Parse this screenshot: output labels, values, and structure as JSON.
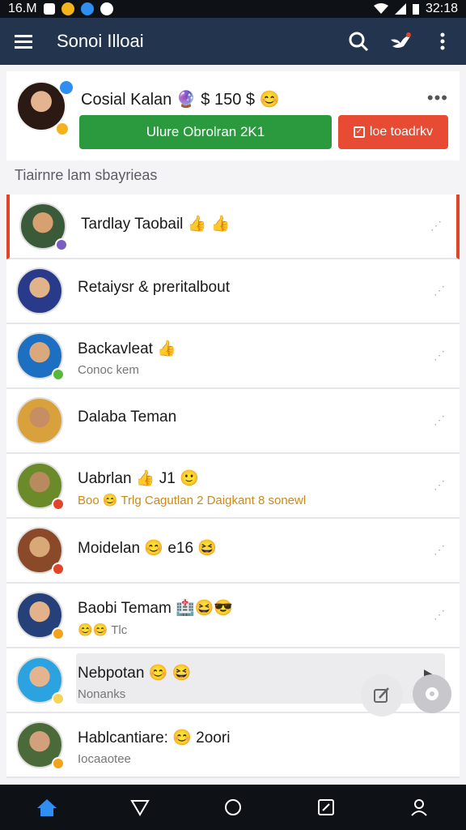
{
  "status_bar": {
    "time_left": "16.M",
    "time_right": "32:18"
  },
  "app_bar": {
    "title": "Sonoi Illoai"
  },
  "profile": {
    "name": "Cosial Kalan 🔮 $ 150 $ 😊",
    "more": "•••",
    "primary_button": "Ulure Obrolran 2K1",
    "secondary_button": "loe toadrkv"
  },
  "section_label": "Tiairnre lam sbayrieas",
  "chats": [
    {
      "name": "Tardlay Taobail 👍 👍",
      "sub": "",
      "badge_color": "#7a5cc2",
      "avatar": [
        "#3a5a3a",
        "#d7a070"
      ]
    },
    {
      "name": "Retaiysr & preritalbout",
      "sub": "",
      "badge_color": "",
      "avatar": [
        "#2a3a8a",
        "#e0b38a"
      ]
    },
    {
      "name": "Backavleat 👍",
      "sub": "Conoc kem",
      "badge_color": "#59b83c",
      "avatar": [
        "#1d6fc2",
        "#d9a87c"
      ]
    },
    {
      "name": "Dalaba Teman",
      "sub": "",
      "badge_color": "",
      "avatar": [
        "#d9a13c",
        "#c78e64"
      ]
    },
    {
      "name": "Uabrlan 👍 J1 🙂",
      "sub": "Boo 😊 Trlg Cagutlan 2 Daigkant 8 sonewl",
      "badge_color": "#e0452a",
      "avatar": [
        "#6b8a2a",
        "#b98a5e"
      ]
    },
    {
      "name": "Moidelan 😊 e16 😆",
      "sub": "",
      "badge_color": "#e0452a",
      "avatar": [
        "#8a4a2a",
        "#d8a877"
      ]
    },
    {
      "name": "Baobi Temam 🏥😆😎",
      "sub": "😊😊 Tlc",
      "badge_color": "#f3a31b",
      "avatar": [
        "#26407a",
        "#e2b28a"
      ]
    },
    {
      "name": "Nebpotan 😊 😆",
      "sub": "Nonanks",
      "badge_color": "#f3d55b",
      "avatar": [
        "#2aa3e0",
        "#e3b48f"
      ]
    },
    {
      "name": "Hablcantiare: 😊 2oori",
      "sub": "Iocaaotee",
      "badge_color": "#f3a31b",
      "avatar": [
        "#4a6a3a",
        "#d2a07a"
      ]
    }
  ]
}
